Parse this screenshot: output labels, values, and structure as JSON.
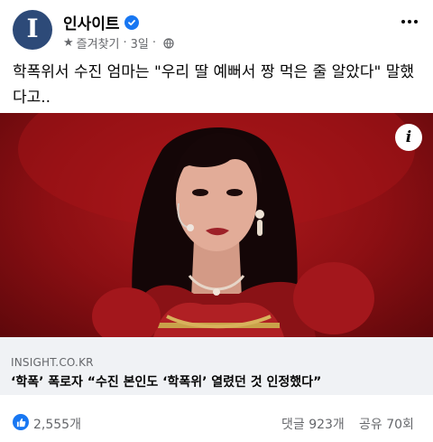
{
  "header": {
    "page_name": "인사이트",
    "avatar_letter": "I",
    "favorites_label": "즐겨찾기",
    "separator": "·",
    "time": "3일",
    "separator2": "·"
  },
  "post": {
    "caption": "학폭위서 수진 엄마는 \"우리 딸 예뻐서 짱 먹은 줄 알았다\" 말했다고.."
  },
  "link": {
    "domain": "INSIGHT.CO.KR",
    "title": "‘학폭’ 폭로자 “수진 본인도 ‘학폭위’ 열렸던 것 인정했다”"
  },
  "reactions": {
    "likes": "2,555개",
    "comments": "댓글 923개",
    "shares": "공유 70회"
  },
  "colors": {
    "accent": "#1877f2",
    "secondary_text": "#65676b",
    "link_bg": "#f0f2f5",
    "media_bg": "#8c0f13"
  },
  "icons": {
    "verified": "verified-badge-icon",
    "favorite": "star-icon",
    "audience": "globe-icon",
    "more": "more-options-icon",
    "info": "info-icon",
    "like": "thumbs-up-icon"
  }
}
